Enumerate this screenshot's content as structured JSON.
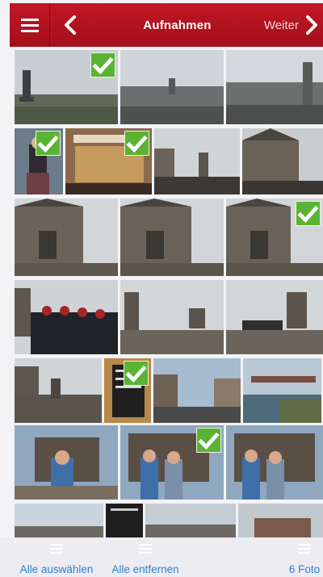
{
  "header": {
    "title": "Aufnahmen",
    "next_label": "Weiter"
  },
  "grid": {
    "selected_count": 6
  },
  "toolbar": {
    "select_all": "Alle auswählen",
    "remove_all": "Alle entfernen",
    "photos_count": "6 Foto"
  },
  "colors": {
    "header_red": "#b5121b",
    "check_green": "#5ab332",
    "toolbar_link": "#2a7fd4"
  },
  "icons": [
    "menu-icon",
    "back-chevron-icon",
    "next-chevron-icon",
    "checkmark-icon",
    "lines-icon"
  ]
}
